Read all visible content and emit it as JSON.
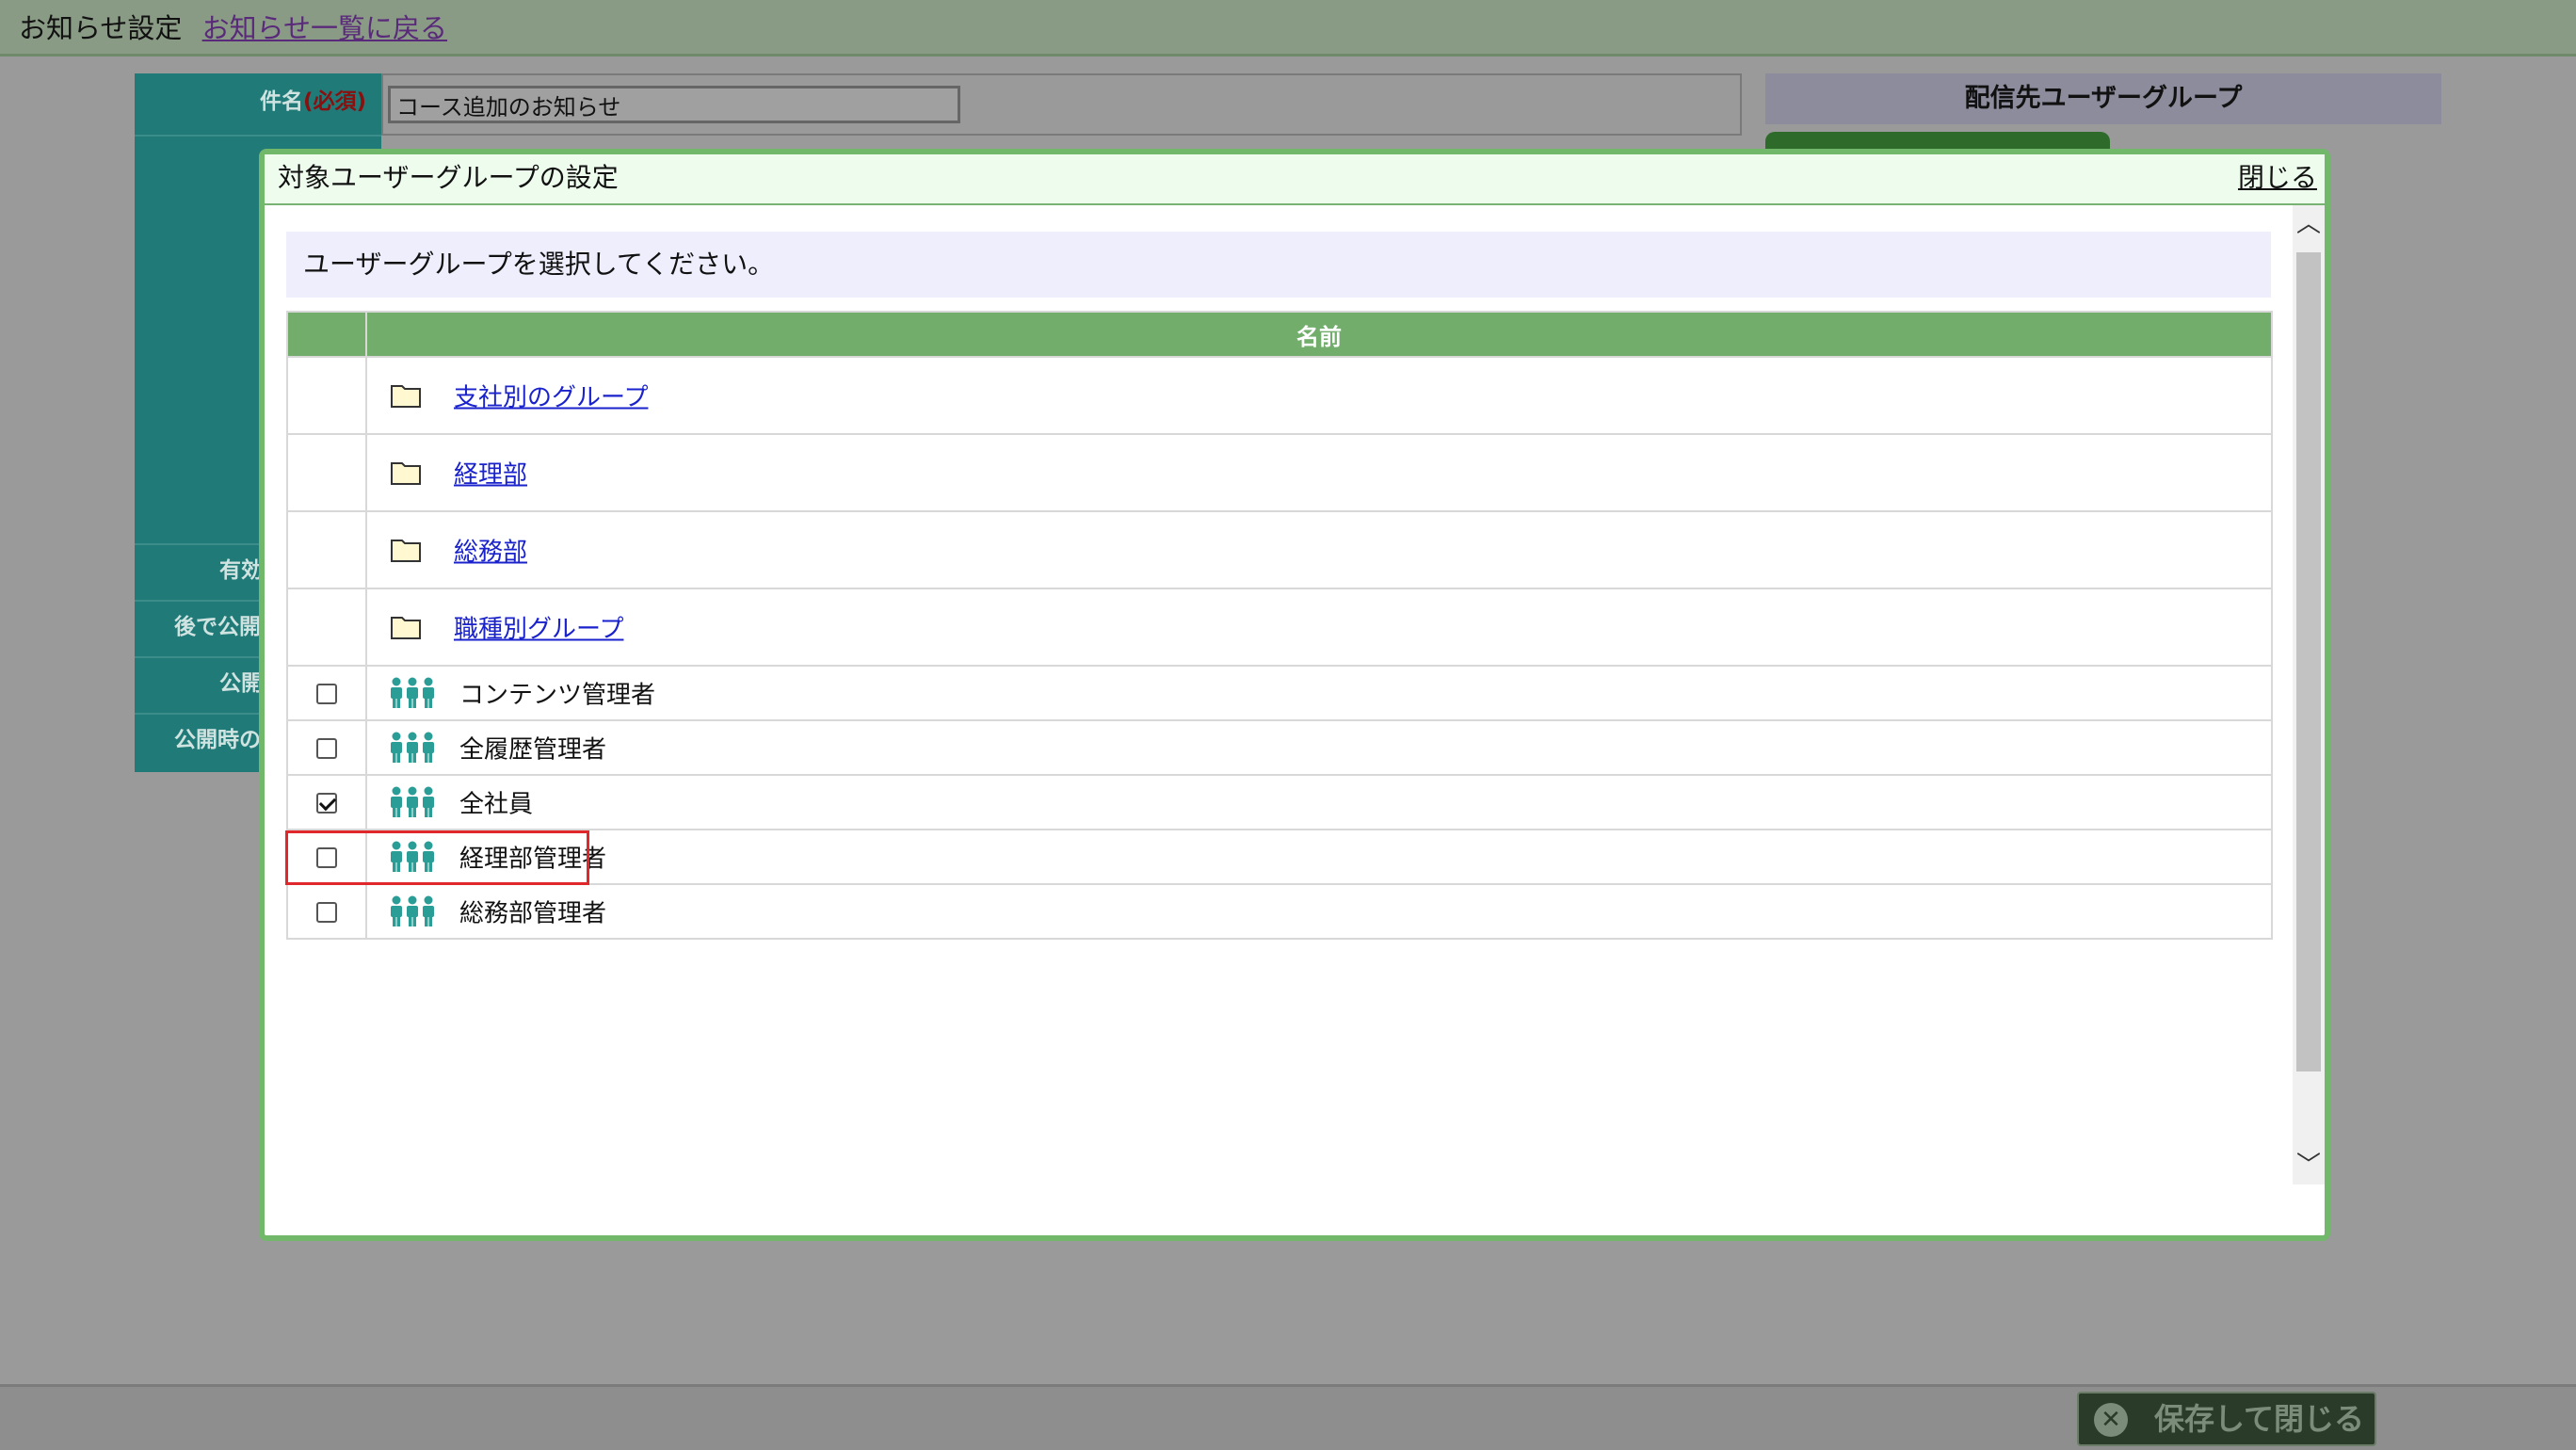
{
  "page": {
    "title": "お知らせ設定",
    "back_link": "お知らせ一覧に戻る"
  },
  "form": {
    "subject_label": "件名",
    "required_mark": "(必須)",
    "subject_value": "コース追加のお知らせ",
    "label_valid": "有効",
    "label_publish_later": "後で公開",
    "label_publish": "公開",
    "label_on_publish": "公開時の"
  },
  "side_panel": {
    "header": "配信先ユーザーグループ"
  },
  "footer": {
    "save_close_label": "保存して閉じる"
  },
  "modal": {
    "title": "対象ユーザーグループの設定",
    "close_label": "閉じる",
    "instruction": "ユーザーグループを選択してください。",
    "column_name": "名前",
    "folders": [
      {
        "label": "支社別のグループ"
      },
      {
        "label": "経理部"
      },
      {
        "label": "総務部"
      },
      {
        "label": "職種別グループ"
      }
    ],
    "groups": [
      {
        "label": "コンテンツ管理者",
        "checked": false
      },
      {
        "label": "全履歴管理者",
        "checked": false
      },
      {
        "label": "全社員",
        "checked": true
      },
      {
        "label": "経理部管理者",
        "checked": false
      },
      {
        "label": "総務部管理者",
        "checked": false
      }
    ]
  },
  "colors": {
    "modal_border": "#72b86a",
    "table_header": "#72ad6c",
    "link": "#1a22cc",
    "highlight": "#e0282c",
    "people_icon": "#2a9d96",
    "folder_icon": "#fff8d0"
  },
  "icons": {
    "folder": "folder-icon",
    "group": "people-group-icon",
    "close": "close-circle-icon"
  }
}
